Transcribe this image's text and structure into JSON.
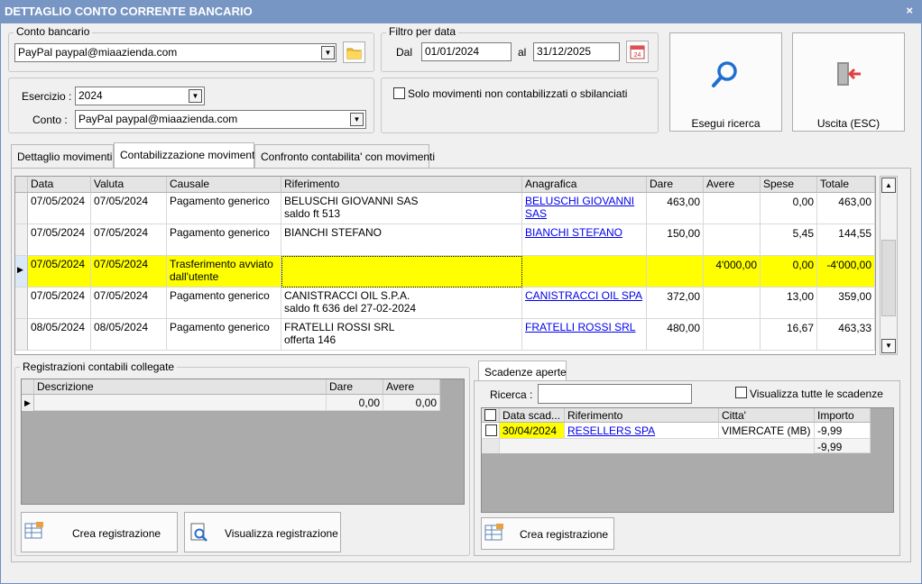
{
  "window": {
    "title": "DETTAGLIO CONTO CORRENTE BANCARIO",
    "close_label": "×"
  },
  "conto_bancario": {
    "legend": "Conto bancario",
    "value": "PayPal paypal@miaazienda.com"
  },
  "filtro": {
    "legend": "Filtro per data",
    "dal_label": "Dal",
    "dal_value": "01/01/2024",
    "al_label": "al",
    "al_value": "31/12/2025"
  },
  "esercizio": {
    "label": "Esercizio :",
    "value": "2024",
    "conto_label": "Conto :",
    "conto_value": "PayPal paypal@miaazienda.com"
  },
  "solo_movimenti": {
    "label": "Solo movimenti non contabilizzati o sbilanciati",
    "checked": false
  },
  "buttons": {
    "search": "Esegui ricerca",
    "exit": "Uscita (ESC)"
  },
  "tabs": [
    {
      "label": "Dettaglio movimenti",
      "active": false
    },
    {
      "label": "Contabilizzazione movimenti",
      "active": true
    },
    {
      "label": "Confronto contabilita' con movimenti",
      "active": false
    }
  ],
  "movements": {
    "columns": [
      "Data",
      "Valuta",
      "Causale",
      "Riferimento",
      "Anagrafica",
      "Dare",
      "Avere",
      "Spese",
      "Totale"
    ],
    "rows": [
      {
        "data": "07/05/2024",
        "valuta": "07/05/2024",
        "causale": "Pagamento generico",
        "rif1": "BELUSCHI GIOVANNI SAS",
        "rif2": "saldo ft 513",
        "anagrafica": "BELUSCHI GIOVANNI SAS",
        "dare": "463,00",
        "avere": "",
        "spese": "0,00",
        "totale": "463,00"
      },
      {
        "data": "07/05/2024",
        "valuta": "07/05/2024",
        "causale": "Pagamento generico",
        "rif1": "BIANCHI STEFANO",
        "rif2": "",
        "anagrafica": "BIANCHI STEFANO",
        "dare": "150,00",
        "avere": "",
        "spese": "5,45",
        "totale": "144,55"
      },
      {
        "data": "07/05/2024",
        "valuta": "07/05/2024",
        "causale": "Trasferimento avviato dall'utente",
        "rif1": "",
        "rif2": "",
        "anagrafica": "",
        "dare": "",
        "avere": "4'000,00",
        "spese": "0,00",
        "totale": "-4'000,00"
      },
      {
        "data": "07/05/2024",
        "valuta": "07/05/2024",
        "causale": "Pagamento generico",
        "rif1": "CANISTRACCI OIL S.P.A.",
        "rif2": "saldo ft 636 del 27-02-2024",
        "anagrafica": "CANISTRACCI OIL SPA",
        "dare": "372,00",
        "avere": "",
        "spese": "13,00",
        "totale": "359,00"
      },
      {
        "data": "08/05/2024",
        "valuta": "08/05/2024",
        "causale": "Pagamento generico",
        "rif1": "FRATELLI ROSSI SRL",
        "rif2": "offerta 146",
        "anagrafica": "FRATELLI ROSSI SRL",
        "dare": "480,00",
        "avere": "",
        "spese": "16,67",
        "totale": "463,33"
      }
    ]
  },
  "registrazioni": {
    "legend": "Registrazioni contabili collegate",
    "columns": [
      "Descrizione",
      "Dare",
      "Avere"
    ],
    "row": {
      "descrizione": "",
      "dare": "0,00",
      "avere": "0,00"
    },
    "btn_create": "Crea registrazione",
    "btn_view": "Visualizza registrazione"
  },
  "scadenze": {
    "tab": "Scadenze aperte",
    "search_label": "Ricerca :",
    "search_value": "",
    "show_all_label": "Visualizza tutte le scadenze",
    "columns": [
      "Data scad...",
      "Riferimento",
      "Citta'",
      "Importo"
    ],
    "rows": [
      {
        "data": "30/04/2024",
        "riferimento": "RESELLERS SPA",
        "citta": "VIMERCATE (MB)",
        "importo": "-9,99"
      }
    ],
    "total": "-9,99",
    "btn_create": "Crea registrazione"
  },
  "colors": {
    "title_bg": "#7896c4",
    "selected_row": "#ffff00",
    "link": "#0000ee",
    "grid_empty": "#ababab"
  },
  "icons": {
    "folder": "folder-icon",
    "calendar": "calendar-icon",
    "search": "search-icon",
    "exit": "exit-door-icon",
    "table": "table-icon",
    "magnifier_doc": "view-document-icon"
  }
}
